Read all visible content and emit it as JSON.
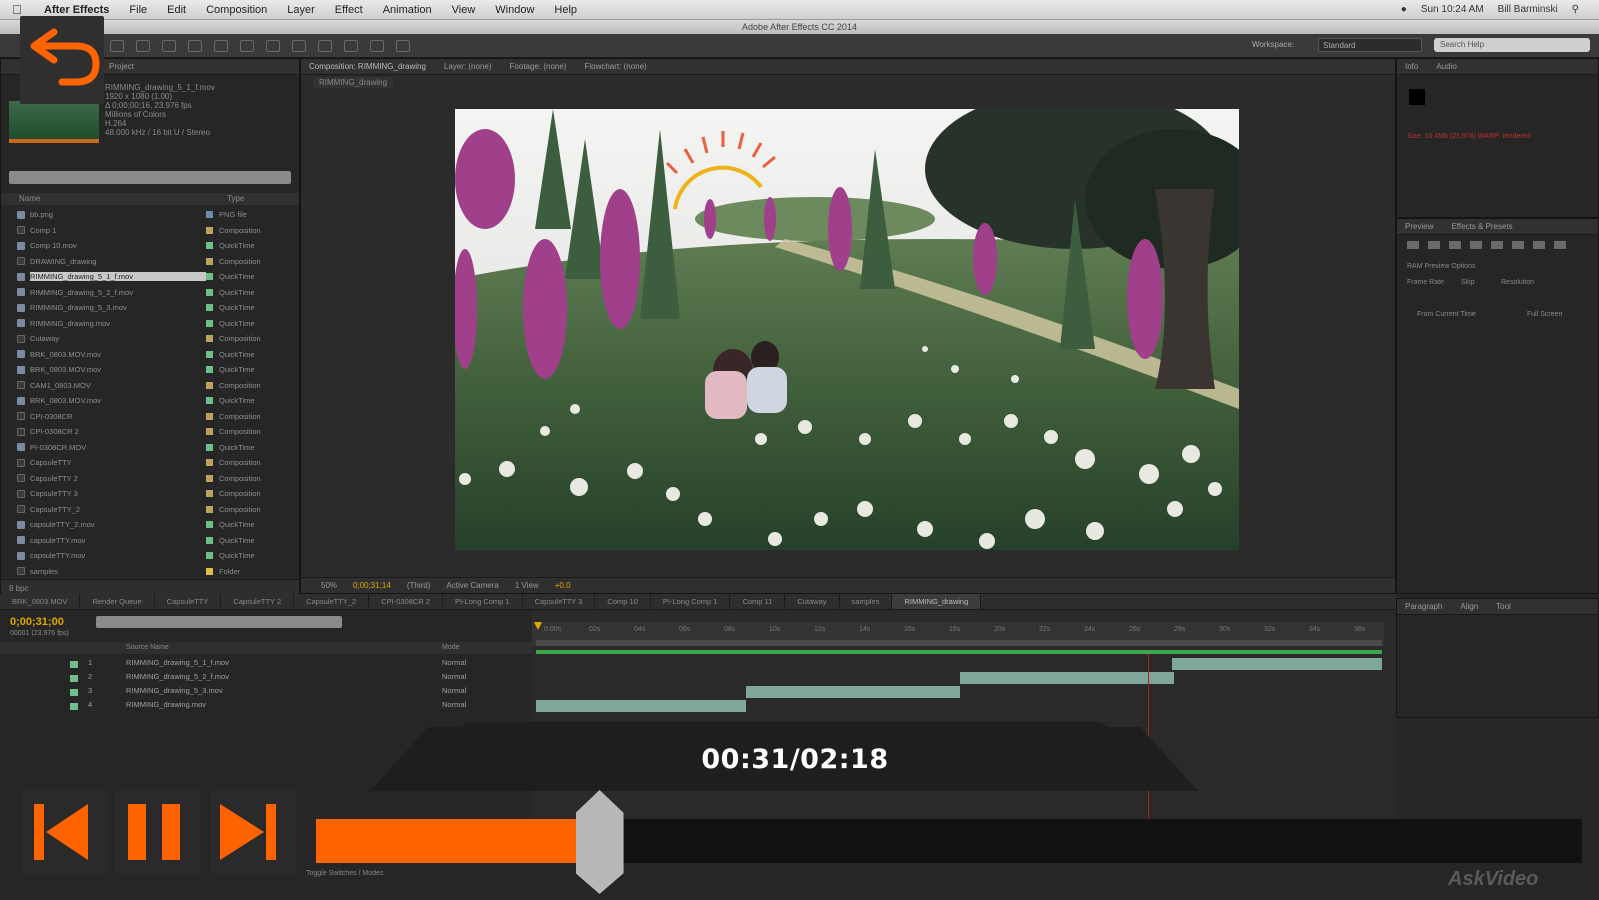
{
  "menubar": {
    "app": "After Effects",
    "items": [
      "File",
      "Edit",
      "Composition",
      "Layer",
      "Effect",
      "Animation",
      "View",
      "Window",
      "Help"
    ],
    "clock": "Sun 10:24 AM",
    "user": "Bill Barminski"
  },
  "window": {
    "title": "Adobe After Effects CC 2014"
  },
  "toolbar": {
    "workspace_label": "Workspace:",
    "workspace_value": "Standard",
    "search_placeholder": "Search Help"
  },
  "project": {
    "tab": "Project",
    "info": [
      "RIMMING_drawing_5_1_f.mov",
      "1920 x 1080 (1.00)",
      "Δ 0;00;00;16, 23.976 fps",
      "Millions of Colors",
      "H.264",
      "48.000 kHz / 16 bit U / Stereo"
    ],
    "col_name": "Name",
    "col_type": "Type",
    "items": [
      {
        "name": "bb.png",
        "type": "PNG file",
        "kind": "file",
        "color": "#6a8ab0"
      },
      {
        "name": "Comp 1",
        "type": "Composition",
        "kind": "folder",
        "color": "#c0a060"
      },
      {
        "name": "Comp 10.mov",
        "type": "QuickTime",
        "kind": "file",
        "color": "#6fbf8a"
      },
      {
        "name": "DRAWING_drawing",
        "type": "Composition",
        "kind": "folder",
        "color": "#c0a060"
      },
      {
        "name": "RIMMING_drawing_5_1_f.mov",
        "type": "QuickTime",
        "kind": "file",
        "color": "#6fbf8a",
        "selected": true
      },
      {
        "name": "RIMMING_drawing_5_2_f.mov",
        "type": "QuickTime",
        "kind": "file",
        "color": "#6fbf8a"
      },
      {
        "name": "RIMMING_drawing_5_3.mov",
        "type": "QuickTime",
        "kind": "file",
        "color": "#6fbf8a"
      },
      {
        "name": "RIMMING_drawing.mov",
        "type": "QuickTime",
        "kind": "file",
        "color": "#6fbf8a"
      },
      {
        "name": "Cutaway",
        "type": "Composition",
        "kind": "folder",
        "color": "#c0a060"
      },
      {
        "name": "BRK_0803.MOV.mov",
        "type": "QuickTime",
        "kind": "file",
        "color": "#6fbf8a"
      },
      {
        "name": "BRK_0803.MOV.mov",
        "type": "QuickTime",
        "kind": "file",
        "color": "#6fbf8a"
      },
      {
        "name": "CAM1_0803.MOV",
        "type": "Composition",
        "kind": "folder",
        "color": "#c0a060"
      },
      {
        "name": "BRK_0803.MOV.mov",
        "type": "QuickTime",
        "kind": "file",
        "color": "#6fbf8a"
      },
      {
        "name": "CPI-0308CR",
        "type": "Composition",
        "kind": "folder",
        "color": "#c0a060"
      },
      {
        "name": "CPI-0308CR 2",
        "type": "Composition",
        "kind": "folder",
        "color": "#c0a060"
      },
      {
        "name": "PI-0308CR.MOV",
        "type": "QuickTime",
        "kind": "file",
        "color": "#6fbf8a"
      },
      {
        "name": "CapsuleTTY",
        "type": "Composition",
        "kind": "folder",
        "color": "#c0a060"
      },
      {
        "name": "CapsuleTTY 2",
        "type": "Composition",
        "kind": "folder",
        "color": "#c0a060"
      },
      {
        "name": "CapsuleTTY 3",
        "type": "Composition",
        "kind": "folder",
        "color": "#c0a060"
      },
      {
        "name": "CapsuleTTY_2",
        "type": "Composition",
        "kind": "folder",
        "color": "#c0a060"
      },
      {
        "name": "capsuleTTY_2.mov",
        "type": "QuickTime",
        "kind": "file",
        "color": "#6fbf8a"
      },
      {
        "name": "capsuleTTY.mov",
        "type": "QuickTime",
        "kind": "file",
        "color": "#6fbf8a"
      },
      {
        "name": "capsuleTTY.mov",
        "type": "QuickTime",
        "kind": "file",
        "color": "#6fbf8a"
      },
      {
        "name": "samples",
        "type": "Folder",
        "kind": "folder",
        "color": "#e0c040"
      }
    ],
    "footer": "8 bpc"
  },
  "composition": {
    "tab": "Composition: RIMMING_drawing",
    "other_tabs": [
      "Layer: (none)",
      "Footage: (none)",
      "Flowchart: (none)"
    ],
    "sub_tab": "RIMMING_drawing",
    "zoom": "50%",
    "timecode": "0;00;31;14",
    "resolution": "(Third)",
    "camera": "Active Camera",
    "view": "1 View",
    "exposure": "+0.0"
  },
  "info_panel": {
    "tab": "Info",
    "audio_tab": "Audio",
    "warning": "Size: 10.4Mb (23.976) WARP: rendered"
  },
  "preview_panel": {
    "tab": "Preview",
    "effects_tab": "Effects & Presets",
    "options": [
      "RAM Preview Options",
      "Frame Rate",
      "Skip",
      "Resolution",
      "From Current Time",
      "Full Screen"
    ]
  },
  "paragraph_panel": {
    "tab": "Paragraph",
    "align_tab": "Align",
    "tool_tab": "Tool"
  },
  "timeline": {
    "tabs": [
      "BRK_0803.MOV",
      "Render Queue",
      "CapsuleTTY",
      "CapsuleTTY 2",
      "CapsuleTTY_2",
      "CPI-0308CR 2",
      "PI-Long Comp 1",
      "CapsuleTTY 3",
      "Comp 10",
      "PI-Long Comp 1",
      "Comp 11",
      "Cutaway",
      "samples",
      "RIMMING_drawing"
    ],
    "timecode": "0;00;31;00",
    "frames": "00001 (23.976 fps)",
    "source_name": "Source Name",
    "mode": "Mode",
    "layers": [
      {
        "idx": "1",
        "name": "RIMMING_drawing_5_1_f.mov",
        "mode": "Normal"
      },
      {
        "idx": "2",
        "name": "RIMMING_drawing_5_2_f.mov",
        "mode": "Normal"
      },
      {
        "idx": "3",
        "name": "RIMMING_drawing_5_3.mov",
        "mode": "Normal"
      },
      {
        "idx": "4",
        "name": "RIMMING_drawing.mov",
        "mode": "Normal"
      }
    ],
    "ruler": [
      "0:00s",
      "02s",
      "04s",
      "06s",
      "08s",
      "10s",
      "12s",
      "14s",
      "16s",
      "18s",
      "20s",
      "22s",
      "24s",
      "26s",
      "28s",
      "30s",
      "32s",
      "34s",
      "36s"
    ],
    "toggle": "Toggle Switches / Modes"
  },
  "player": {
    "time": "00:31/02:18",
    "progress": 0.224,
    "brand": "AskVideo"
  },
  "colors": {
    "accent": "#ff6400",
    "timecode": "#e0a800",
    "layer_bar": "#7fa69a",
    "work_area": "#3fa64b"
  }
}
